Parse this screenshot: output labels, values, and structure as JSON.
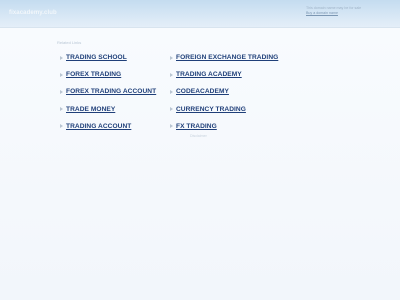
{
  "header": {
    "site_title": "fixacademy.club",
    "notice_text": "This domain name may be for sale",
    "notice_link": "Buy a domain name"
  },
  "main": {
    "related_label": "Related Links",
    "left_links": [
      {
        "label": "TRADING SCHOOL"
      },
      {
        "label": "FOREX TRADING"
      },
      {
        "label": "FOREX TRADING ACCOUNT"
      },
      {
        "label": "TRADE MONEY"
      },
      {
        "label": "TRADING ACCOUNT"
      }
    ],
    "right_links": [
      {
        "label": "FOREIGN EXCHANGE TRADING"
      },
      {
        "label": "TRADING ACADEMY"
      },
      {
        "label": "CODEACADEMY"
      },
      {
        "label": "CURRENCY TRADING"
      },
      {
        "label": "FX TRADING"
      }
    ],
    "disclaimer": "Disclaimer"
  }
}
